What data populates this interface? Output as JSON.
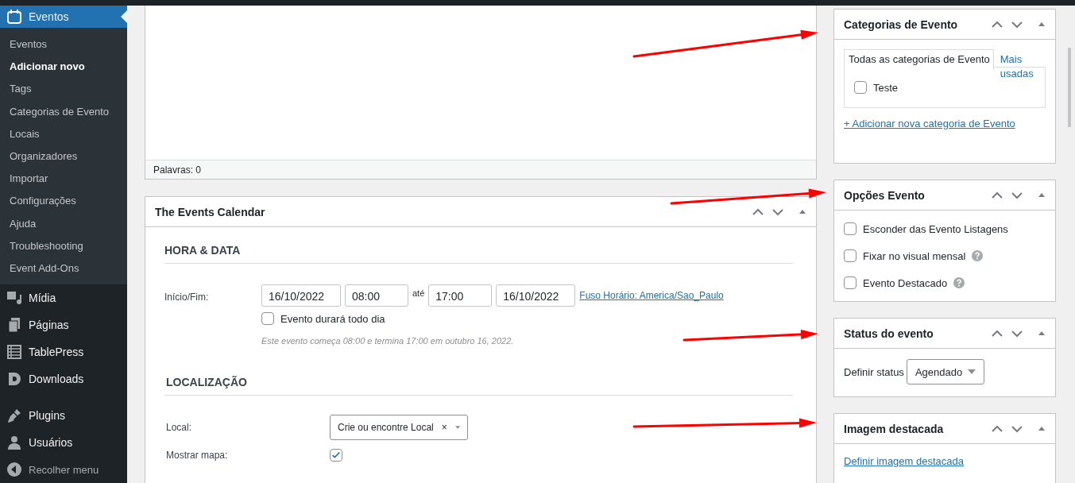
{
  "sidebar": {
    "current": {
      "label": "Eventos",
      "selected": true
    },
    "submenu": [
      {
        "label": "Eventos",
        "selected": false
      },
      {
        "label": "Adicionar novo",
        "selected": true
      },
      {
        "label": "Tags",
        "selected": false
      },
      {
        "label": "Categorias de Evento",
        "selected": false
      },
      {
        "label": "Locais",
        "selected": false
      },
      {
        "label": "Organizadores",
        "selected": false
      },
      {
        "label": "Importar",
        "selected": false
      },
      {
        "label": "Configurações",
        "selected": false
      },
      {
        "label": "Ajuda",
        "selected": false
      },
      {
        "label": "Troubleshooting",
        "selected": false
      },
      {
        "label": "Event Add-Ons",
        "selected": false
      }
    ],
    "items": [
      {
        "label": "Mídia"
      },
      {
        "label": "Páginas"
      },
      {
        "label": "TablePress"
      },
      {
        "label": "Downloads"
      },
      {
        "label": "Plugins"
      },
      {
        "label": "Usuários"
      }
    ],
    "collapse": "Recolher menu"
  },
  "editor": {
    "word_count": "Palavras: 0"
  },
  "events_calendar": {
    "title": "The Events Calendar",
    "date_section": {
      "heading": "HORA & DATA",
      "label": "Início/Fim:",
      "start_date": "16/10/2022",
      "start_time": "08:00",
      "separator": "até",
      "end_time": "17:00",
      "end_date": "16/10/2022",
      "timezone_link": "Fuso Horário: America/Sao_Paulo",
      "all_day": {
        "label": "Evento durará todo dia",
        "checked": false
      },
      "summary": "Este evento começa 08:00 e termina 17:00 em outubro 16, 2022."
    },
    "location_section": {
      "heading": "LOCALIZAÇÃO",
      "venue_label": "Local:",
      "venue_value": "Crie ou encontre Local",
      "clear": "×",
      "show_map": {
        "label": "Mostrar mapa:",
        "checked": true
      }
    }
  },
  "categories": {
    "title": "Categorias de Evento",
    "tabs": [
      {
        "label": "Todas as categorias de Evento",
        "selected": true
      },
      {
        "label": "Mais usadas",
        "selected": false
      }
    ],
    "items": [
      {
        "label": "Teste",
        "checked": false
      }
    ],
    "add_link": "+ Adicionar nova categoria de Evento"
  },
  "options": {
    "title": "Opções Evento",
    "items": [
      {
        "label": "Esconder das Evento Listagens",
        "checked": false,
        "help": false
      },
      {
        "label": "Fixar no visual mensal",
        "checked": false,
        "help": true
      },
      {
        "label": "Evento Destacado",
        "checked": false,
        "help": true
      }
    ]
  },
  "status": {
    "title": "Status do evento",
    "label": "Definir status",
    "value": "Agendado"
  },
  "featured_image": {
    "title": "Imagem destacada",
    "link": "Definir imagem destacada"
  }
}
